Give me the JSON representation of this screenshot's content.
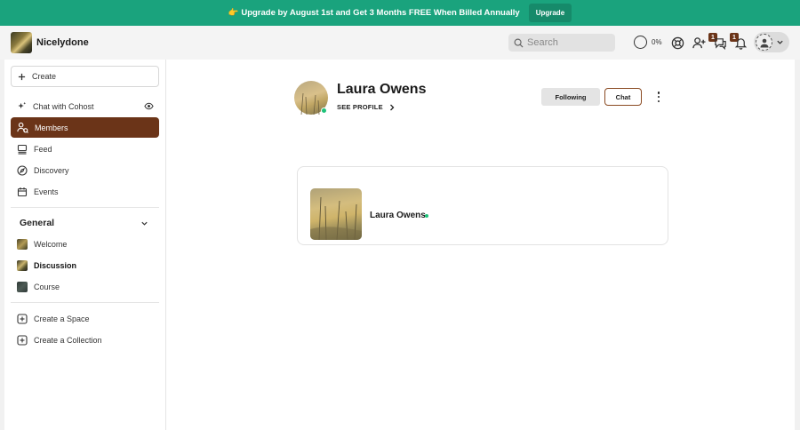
{
  "banner": {
    "text": "👉 Upgrade by August 1st and Get 3 Months FREE When Billed Annually",
    "button": "Upgrade"
  },
  "header": {
    "brand": "Nicelydone",
    "search_placeholder": "Search",
    "progress_label": "0%",
    "invites_badge": "1",
    "messages_badge": "1",
    "icons": [
      "search-icon",
      "progress-ring-icon",
      "support-icon",
      "add-user-icon",
      "messages-icon",
      "bell-icon",
      "avatar-icon",
      "chevron-down-icon"
    ]
  },
  "sidebar": {
    "create_label": "Create",
    "items": [
      {
        "label": "Chat with Cohost",
        "icon": "sparkle-icon"
      },
      {
        "label": "Members",
        "icon": "members-icon",
        "active": true
      },
      {
        "label": "Feed",
        "icon": "feed-icon"
      },
      {
        "label": "Discovery",
        "icon": "compass-icon"
      },
      {
        "label": "Events",
        "icon": "calendar-icon"
      }
    ],
    "section_title": "General",
    "spaces": [
      {
        "label": "Welcome"
      },
      {
        "label": "Discussion"
      },
      {
        "label": "Course"
      }
    ],
    "actions": [
      {
        "label": "Create a Space"
      },
      {
        "label": "Create a Collection"
      }
    ]
  },
  "profile": {
    "name": "Laura Owens",
    "see_profile": "SEE PROFILE",
    "following_label": "Following",
    "chat_label": "Chat"
  },
  "member_card": {
    "name": "Laura Owens"
  },
  "colors": {
    "banner": "#1aa37d",
    "accent": "#6b3418",
    "online": "#1ec27a"
  }
}
